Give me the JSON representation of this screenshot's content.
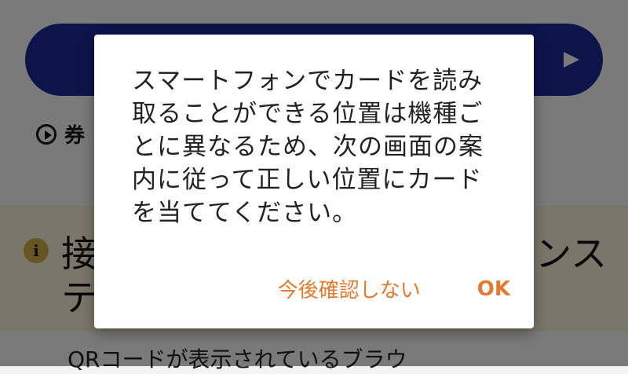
{
  "background": {
    "video_link_label": "券",
    "notice": {
      "title_start": "接",
      "title_end": "ンス",
      "title_line2": "テ",
      "body_preview": "QRコードが表示されているブラウ"
    }
  },
  "dialog": {
    "message": "スマートフォンでカードを読み取ることができる位置は機種ごとに異なるため、次の画面の案内に従って正しい位置にカードを当ててください。",
    "dont_show_again_label": "今後確認しない",
    "ok_label": "OK"
  },
  "colors": {
    "accent": "#e8792a",
    "primary_button": "#1b2a9c",
    "notice_bg": "#fff7dd"
  }
}
